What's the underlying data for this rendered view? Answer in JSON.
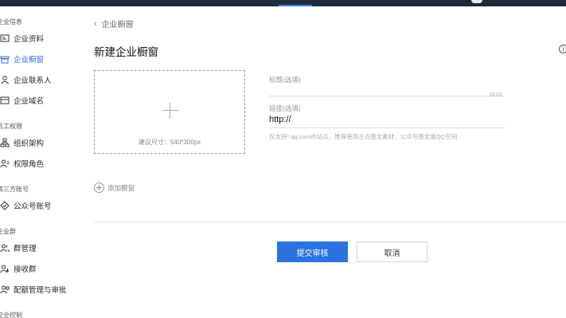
{
  "sidebar": {
    "sections": [
      {
        "title": "企业信息",
        "items": [
          {
            "label": "企业资料",
            "icon": "id-card-icon"
          },
          {
            "label": "企业橱窗",
            "icon": "storefront-icon",
            "active": true
          },
          {
            "label": "企业联系人",
            "icon": "contact-person-icon"
          },
          {
            "label": "企业域名",
            "icon": "domain-icon"
          }
        ]
      },
      {
        "title": "员工权限",
        "items": [
          {
            "label": "组织架构",
            "icon": "org-chart-icon"
          },
          {
            "label": "权限角色",
            "icon": "role-icon"
          }
        ]
      },
      {
        "title": "第三方账号",
        "items": [
          {
            "label": "公众号账号",
            "icon": "official-account-icon"
          }
        ]
      },
      {
        "title": "企业群",
        "items": [
          {
            "label": "群管理",
            "icon": "group-manage-icon"
          },
          {
            "label": "接收群",
            "icon": "group-receive-icon"
          },
          {
            "label": "配额管理与审批",
            "icon": "quota-approval-icon"
          }
        ]
      },
      {
        "title": "安全控制",
        "items": []
      }
    ]
  },
  "breadcrumb": {
    "back_label": "企业橱窗"
  },
  "page": {
    "title": "新建企业橱窗"
  },
  "upload": {
    "hint": "建议尺寸：540*300px"
  },
  "form": {
    "title_label": "标题(选填)",
    "title_value": "",
    "title_counter": "0/10",
    "link_label": "链接(选填)",
    "link_value": "http://",
    "link_tip": "仅支持*.qq.com的站点，推荐使用企点图文素材、公众号图文或QQ空间"
  },
  "add_window": {
    "label": "添加橱窗"
  },
  "actions": {
    "submit_label": "提交审核",
    "cancel_label": "取消"
  },
  "colors": {
    "accent": "#2b72e0",
    "topbar": "#1f2a3a",
    "active_text": "#2f6fd8"
  }
}
